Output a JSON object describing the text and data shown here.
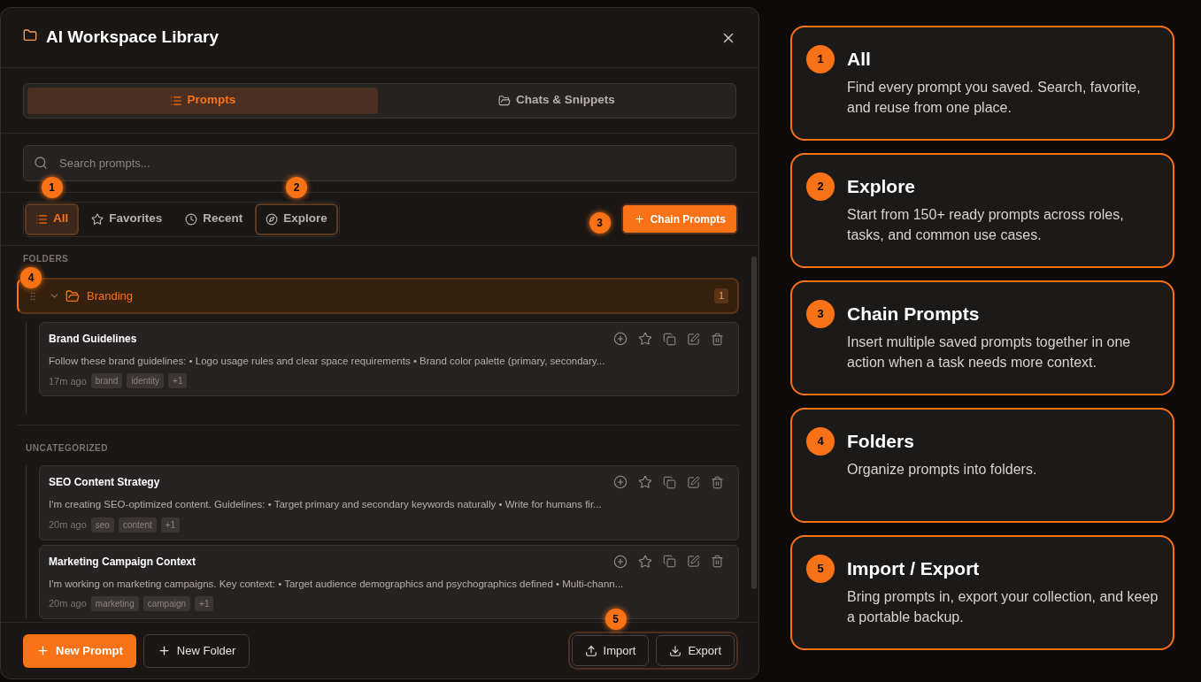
{
  "window": {
    "title": "AI Workspace Library"
  },
  "tabs": [
    {
      "label": "Prompts",
      "selected": true,
      "kind": "list"
    },
    {
      "label": "Chats & Snippets",
      "selected": false,
      "kind": "folder"
    }
  ],
  "search": {
    "placeholder": "Search prompts..."
  },
  "filters": [
    {
      "label": "All",
      "selected": true,
      "kind": "list",
      "marker": "1"
    },
    {
      "label": "Favorites",
      "selected": false,
      "kind": "star"
    },
    {
      "label": "Recent",
      "selected": false,
      "kind": "clock"
    },
    {
      "label": "Explore",
      "selected": false,
      "kind": "compass",
      "marker": "2"
    }
  ],
  "chain_button": {
    "label": "Chain Prompts",
    "marker": "3"
  },
  "folders_section": {
    "label": "FOLDERS",
    "folders": [
      {
        "name": "Branding",
        "count": "1",
        "expanded": true,
        "marker": "4",
        "prompts": [
          {
            "title": "Brand Guidelines",
            "text": "Follow these brand guidelines: • Logo usage rules and clear space requirements • Brand color palette (primary, secondary...",
            "time": "17m ago",
            "tags": [
              "brand",
              "identity",
              "+1"
            ]
          }
        ]
      }
    ]
  },
  "uncategorized": {
    "label": "UNCATEGORIZED",
    "prompts": [
      {
        "title": "SEO Content Strategy",
        "text": "I'm creating SEO-optimized content. Guidelines: • Target primary and secondary keywords naturally • Write for humans fir...",
        "time": "20m ago",
        "tags": [
          "seo",
          "content",
          "+1"
        ]
      },
      {
        "title": "Marketing Campaign Context",
        "text": "I'm working on marketing campaigns. Key context: • Target audience demographics and psychographics defined • Multi-chann...",
        "time": "20m ago",
        "tags": [
          "marketing",
          "campaign",
          "+1"
        ]
      }
    ]
  },
  "footer": {
    "new_prompt": "New Prompt",
    "new_folder": "New Folder",
    "import": "Import",
    "export": "Export",
    "marker": "5"
  },
  "callouts": [
    {
      "number": "1",
      "title": "All",
      "text": "Find every prompt you saved. Search, favorite, and reuse from one place."
    },
    {
      "number": "2",
      "title": "Explore",
      "text": "Start from 150+ ready prompts across roles, tasks, and common use cases."
    },
    {
      "number": "3",
      "title": "Chain Prompts",
      "text": "Insert multiple saved prompts together in one action when a task needs more context."
    },
    {
      "number": "4",
      "title": "Folders",
      "text": "Organize prompts into folders."
    },
    {
      "number": "5",
      "title": "Import / Export",
      "text": "Bring prompts in, export your collection, and keep a portable backup."
    }
  ]
}
